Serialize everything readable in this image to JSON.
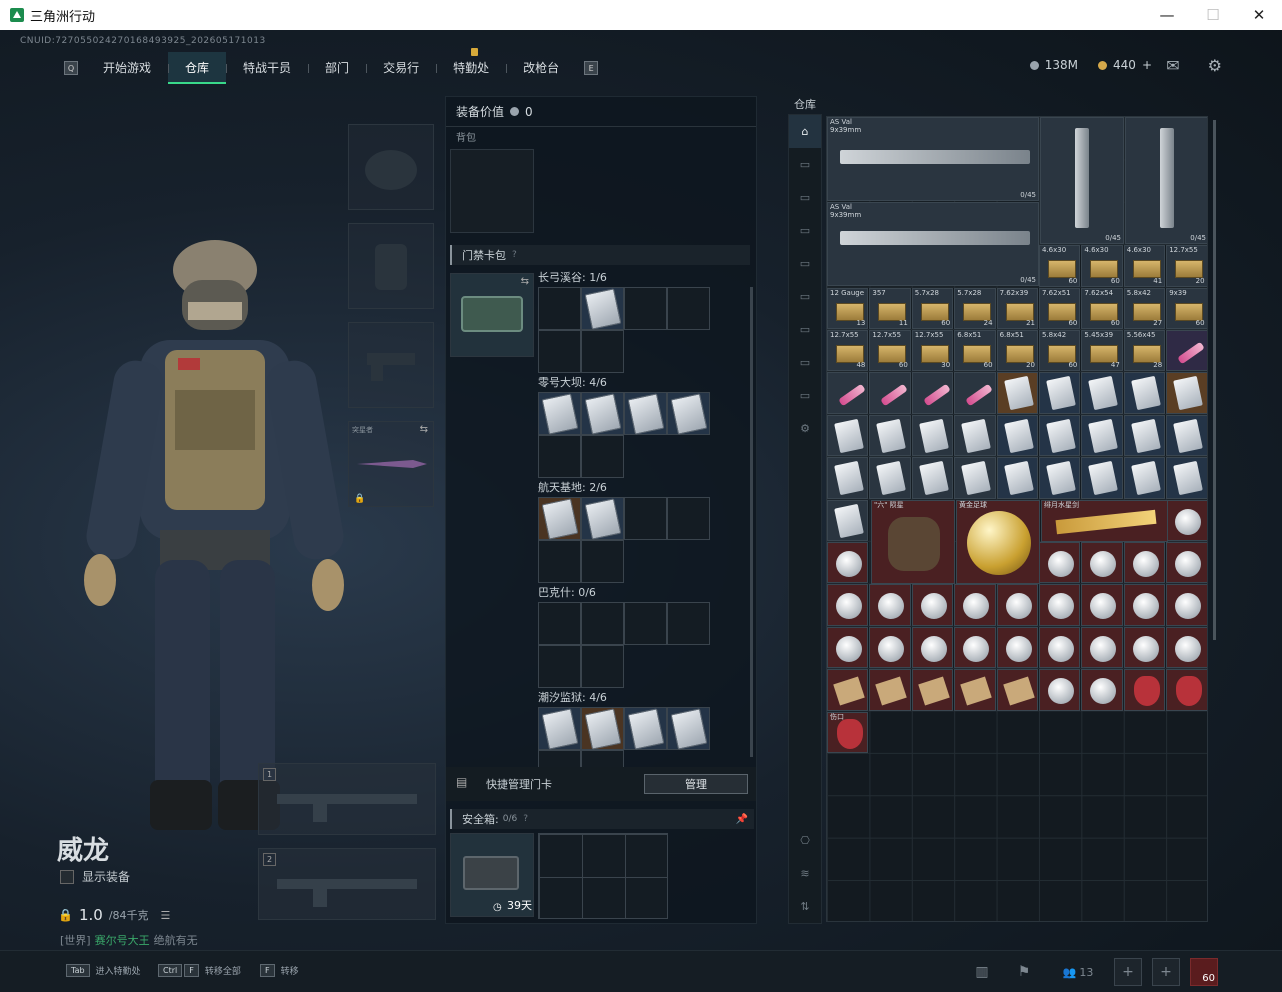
{
  "window": {
    "title": "三角洲行动",
    "controls": {
      "minimize": "—",
      "maximize": "☐",
      "close": "✕"
    }
  },
  "uid": "CNUID:727055024270168493925_202605171013",
  "nav": {
    "left_key": "Q",
    "right_key": "E",
    "tabs": [
      {
        "label": "开始游戏"
      },
      {
        "label": "仓库"
      },
      {
        "label": "特战干员"
      },
      {
        "label": "部门"
      },
      {
        "label": "交易行"
      },
      {
        "label": "特勤处"
      },
      {
        "label": "改枪台"
      }
    ]
  },
  "currency": {
    "silver": "138M",
    "gold": "440",
    "add": "+"
  },
  "character": {
    "name": "威龙",
    "show_equipment": "显示装备",
    "weight": "1.0",
    "weight_max": "/84千克"
  },
  "chat": {
    "channel": "[世界]",
    "user": "赛尔号大王",
    "message": "绝航有无"
  },
  "left_slots": {
    "melee_label": "突星者",
    "weapon1": "1",
    "weapon2": "2"
  },
  "middle": {
    "equip_value_label": "装备价值",
    "equip_value": "0",
    "backpack_label": "背包",
    "keycard_section": "门禁卡包",
    "rooms": [
      {
        "label": "长弓溪谷: 1/6"
      },
      {
        "label": "零号大坝: 4/6"
      },
      {
        "label": "航天基地: 2/6"
      },
      {
        "label": "巴克什: 0/6"
      },
      {
        "label": "潮汐监狱: 4/6"
      }
    ],
    "quick_manage_label": "快捷管理门卡",
    "manage_button": "管理",
    "safebox_label": "安全箱:",
    "safebox_count": "0/6",
    "safebox_days": "39天"
  },
  "warehouse": {
    "title": "仓库",
    "items": [
      {
        "name": "AS Val",
        "sub": "9x39mm",
        "count": "0/45"
      },
      {
        "name": "AS Val",
        "sub": "9x39mm",
        "count": "0/45"
      },
      {
        "name": "",
        "sub": "",
        "count": "0/45"
      },
      {
        "name": "",
        "sub": "",
        "count": "0/45"
      }
    ],
    "ammo_counts": [
      "60",
      "60",
      "41",
      "20",
      "13",
      "11",
      "60",
      "24",
      "21",
      "60",
      "60",
      "27",
      "60",
      "48",
      "60",
      "30",
      "60",
      "20",
      "60",
      "47",
      "28"
    ],
    "ammo_names": [
      "4.6x30",
      "4.6x30",
      "4.6x30",
      "12.7x55",
      "12 Gauge",
      "357",
      "5.7x28",
      "5.7x28",
      "7.62x39",
      "7.62x51",
      "7.62x54",
      "5.8x42",
      "9x39",
      "12.7x55",
      "12.7x55",
      "12.7x55",
      "6.8x51",
      "6.8x51",
      "5.8x42",
      "5.45x39",
      "5.56x45"
    ],
    "special": {
      "grip": "\"六\" 陨星",
      "ball": "黄金足球",
      "sword": "绯月水星剑",
      "ruby_mask": "伤口"
    }
  },
  "bottom": {
    "hints": [
      {
        "key": "Tab",
        "label": "进入特勤处"
      },
      {
        "key": "Ctrl",
        "key2": "F",
        "label": "转移全部"
      },
      {
        "key": "F",
        "label": "转移"
      }
    ],
    "friends": "13",
    "level": "60"
  }
}
